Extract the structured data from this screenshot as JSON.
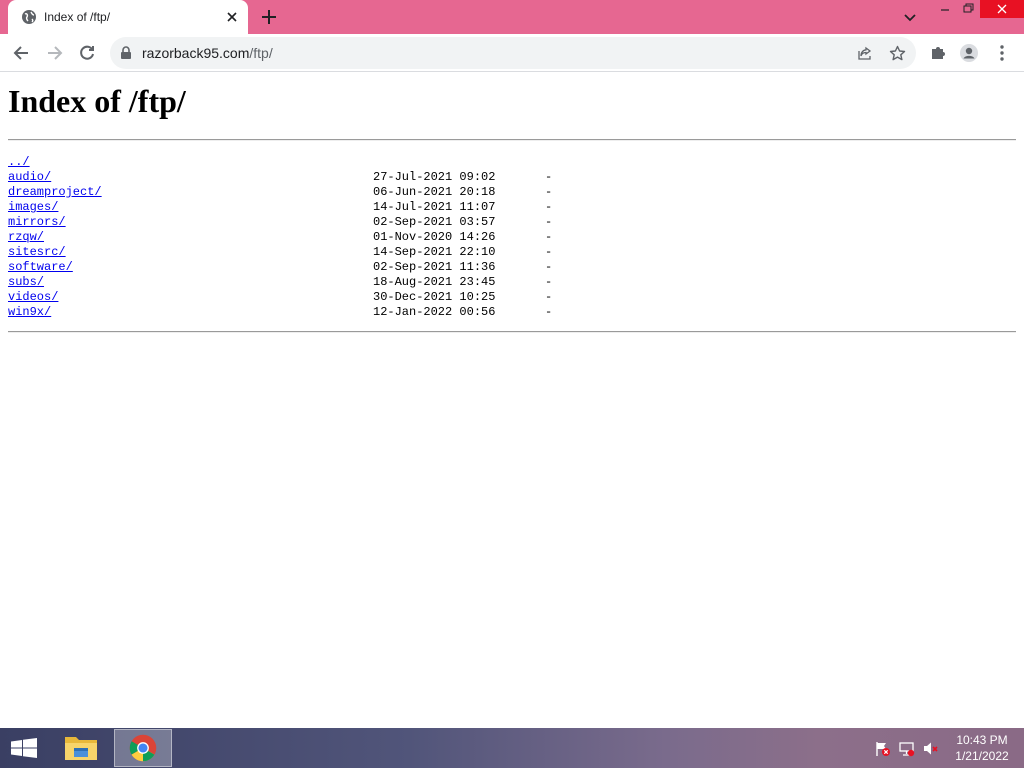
{
  "browser": {
    "tab": {
      "title": "Index of /ftp/"
    },
    "address_bar": {
      "host": "razorback95.com",
      "path": "/ftp/"
    },
    "theme_color": "#e66791"
  },
  "page": {
    "heading": "Index of /ftp/",
    "link_color": "#0000ee",
    "entries": [
      {
        "name": "../",
        "date": "",
        "size": ""
      },
      {
        "name": "audio/",
        "date": "27-Jul-2021 09:02",
        "size": "-"
      },
      {
        "name": "dreamproject/",
        "date": "06-Jun-2021 20:18",
        "size": "-"
      },
      {
        "name": "images/",
        "date": "14-Jul-2021 11:07",
        "size": "-"
      },
      {
        "name": "mirrors/",
        "date": "02-Sep-2021 03:57",
        "size": "-"
      },
      {
        "name": "rzqw/",
        "date": "01-Nov-2020 14:26",
        "size": "-"
      },
      {
        "name": "sitesrc/",
        "date": "14-Sep-2021 22:10",
        "size": "-"
      },
      {
        "name": "software/",
        "date": "02-Sep-2021 11:36",
        "size": "-"
      },
      {
        "name": "subs/",
        "date": "18-Aug-2021 23:45",
        "size": "-"
      },
      {
        "name": "videos/",
        "date": "30-Dec-2021 10:25",
        "size": "-"
      },
      {
        "name": "win9x/",
        "date": "12-Jan-2022 00:56",
        "size": "-"
      }
    ]
  },
  "taskbar": {
    "apps": [
      "file-explorer-icon",
      "chrome-icon"
    ],
    "tray": [
      "action-center-flag-icon",
      "network-icon",
      "volume-muted-icon"
    ],
    "time": "10:43 PM",
    "date": "1/21/2022"
  }
}
